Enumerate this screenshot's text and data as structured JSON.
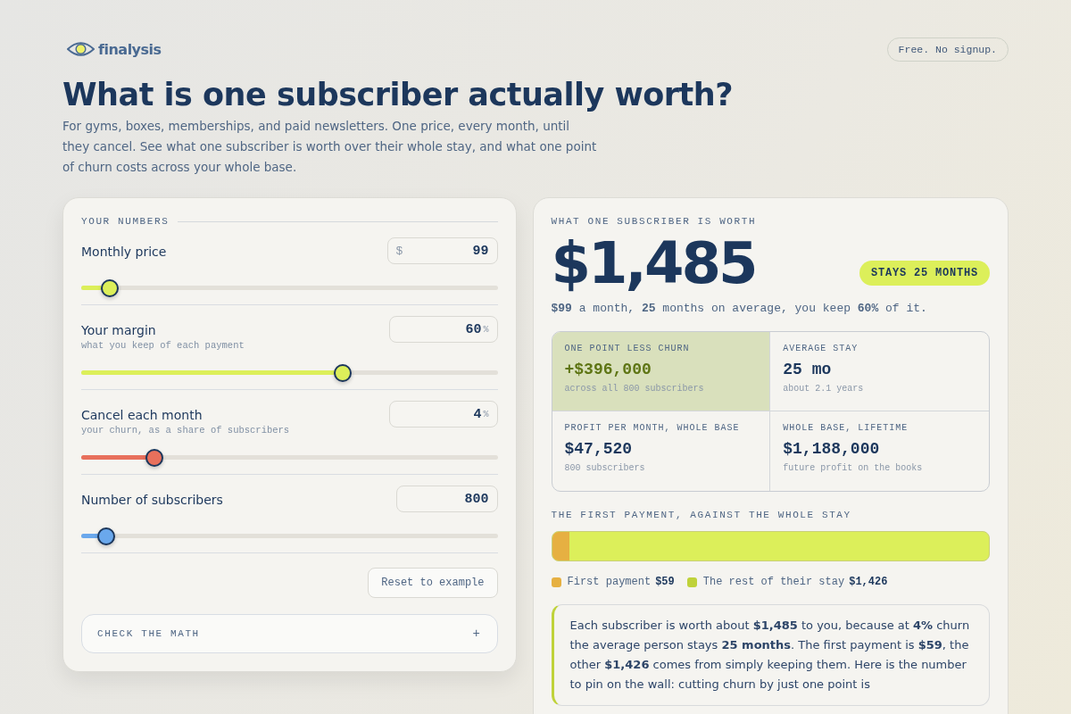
{
  "brand": {
    "name": "finalysis"
  },
  "badge": "Free. No signup.",
  "title": "What is one subscriber actually worth?",
  "intro": "For gyms, boxes, memberships, and paid newsletters. One price, every month, until they cancel. See what one subscriber is worth over their whole stay, and what one point of churn costs across your whole base.",
  "inputs": {
    "heading": "YOUR NUMBERS",
    "fields": [
      {
        "label": "Monthly price",
        "prefix": "$",
        "value": "99",
        "level": 0.066,
        "color": "#dcef5a"
      },
      {
        "label": "Your margin",
        "hint": "what you keep of each payment",
        "value": "60",
        "suffix": "%",
        "level": 0.625,
        "color": "#dcef5a"
      },
      {
        "label": "Cancel each month",
        "hint": "your churn, as a share of subscribers",
        "value": "4",
        "suffix": "%",
        "level": 0.173,
        "color": "#e8705c"
      },
      {
        "label": "Number of subscribers",
        "value": "800",
        "level": 0.058,
        "color": "#6aa8ec"
      }
    ],
    "reset": "Reset to example",
    "check_math": {
      "label": "CHECK THE MATH",
      "icon": "+",
      "expanded": false
    }
  },
  "result": {
    "heading": "WHAT ONE SUBSCRIBER IS WORTH",
    "value": "$1,485",
    "pill": "STAYS 25 MONTHS",
    "summary": "**$99** a month, **25** months on average, you keep **60%** of it.",
    "stats": [
      {
        "label": "ONE POINT LESS CHURN",
        "value": "+$396,000",
        "note": "across all 800 subscribers",
        "highlighted": true
      },
      {
        "label": "AVERAGE STAY",
        "value": "25 mo",
        "note": "about 2.1 years",
        "highlighted": false
      },
      {
        "label": "PROFIT PER MONTH, WHOLE BASE",
        "value": "$47,520",
        "note": "800 subscribers",
        "highlighted": false
      },
      {
        "label": "WHOLE BASE, LIFETIME",
        "value": "$1,188,000",
        "note": "future profit on the books",
        "highlighted": false
      }
    ],
    "split": {
      "heading": "THE FIRST PAYMENT, AGAINST THE WHOLE STAY",
      "level": 0.04,
      "legend": [
        {
          "label": "First payment",
          "amount": "$59",
          "color": "#e6b042"
        },
        {
          "label": "The rest of their stay",
          "amount": "$1,426",
          "color": "#bfd23a"
        }
      ]
    },
    "explanation": "Each subscriber is worth about **$1,485** to you, because at **4%** churn the average person stays **25 months**. The first payment is **$59**, the other **$1,426** comes from simply keeping them. Here is the number to pin on the wall: cutting churn by just one point is"
  }
}
